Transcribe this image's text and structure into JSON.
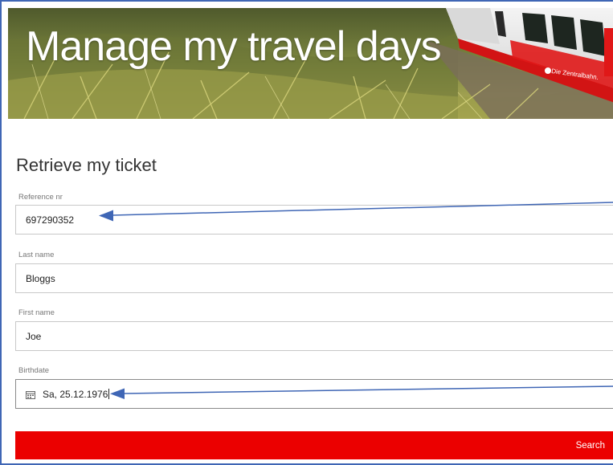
{
  "hero": {
    "title": "Manage my travel days",
    "train_logo_text": "Die Zentralbahn."
  },
  "form": {
    "title": "Retrieve my ticket",
    "fields": [
      {
        "label": "Reference nr",
        "value": "697290352"
      },
      {
        "label": "Last name",
        "value": "Bloggs"
      },
      {
        "label": "First name",
        "value": "Joe"
      },
      {
        "label": "Birthdate",
        "value": "Sa, 25.12.1976"
      }
    ],
    "search_label": "Search"
  },
  "colors": {
    "accent": "#eb0000",
    "annotation_arrow": "#3f66b5",
    "frame": "#3f66b5"
  },
  "icons": {
    "birthdate_icon": "calendar-icon",
    "annotation": "arrow-annotation-icon"
  }
}
